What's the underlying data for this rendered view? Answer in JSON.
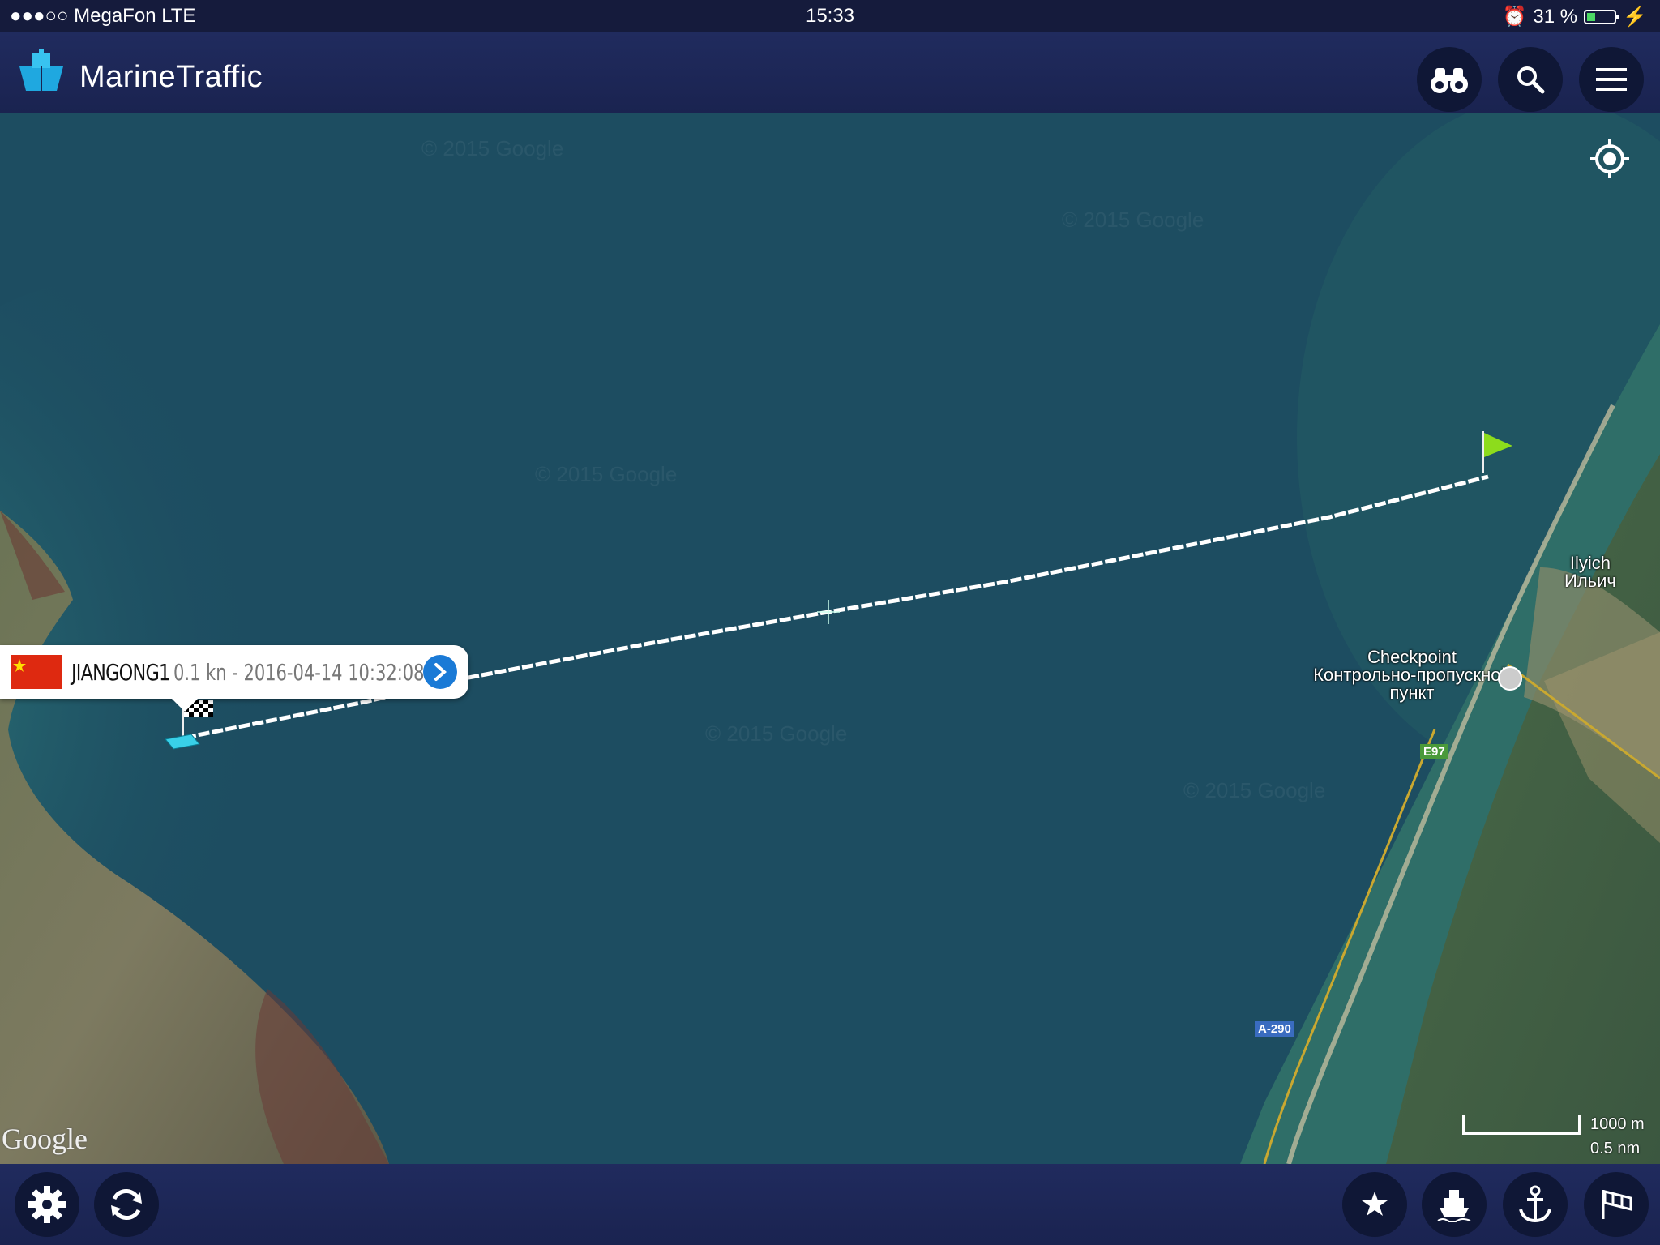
{
  "status_bar": {
    "carrier": "●●●○○ MegaFon  LTE",
    "time": "15:33",
    "battery": "31 %",
    "battery_level": 0.31
  },
  "app": {
    "title": "MarineTraffic"
  },
  "vessel": {
    "name": "JIANGONG1",
    "info": "0.1 kn - 2016-04-14 10:32:08"
  },
  "map_labels": {
    "ilyich_lat": "Ilyich",
    "ilyich_cyr": "Ильич",
    "checkpoint_en": "Checkpoint",
    "checkpoint_ru_1": "Контрольно-пропускной",
    "checkpoint_ru_2": "пункт",
    "road_e97": "E97",
    "road_a290": "A-290"
  },
  "attribution": {
    "google": "Google",
    "watermark": "© 2015 Google"
  },
  "scale": {
    "meters": "1000 m",
    "nautical": "0.5 nm"
  },
  "playback": {
    "progress": 0.0
  },
  "colors": {
    "bar": "#1a2350",
    "accent": "#1a7ad6",
    "track": "#ffffff",
    "start_flag": "#8ddc1c"
  },
  "icons": {
    "binoculars": "binoculars-icon",
    "search": "search-icon",
    "menu": "menu-icon",
    "locate": "locate-icon",
    "settings": "gear-icon",
    "refresh": "refresh-icon",
    "favorite": "star-icon",
    "vessel": "ship-icon",
    "port": "anchor-icon",
    "wind": "wind-icon"
  }
}
